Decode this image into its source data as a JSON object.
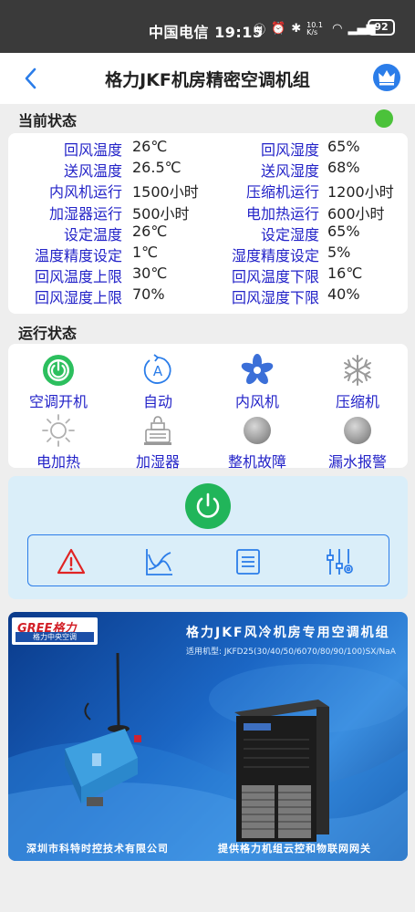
{
  "status_bar": {
    "carrier_time": "中国电信 19:15",
    "net_speed": "10.1 K/s",
    "battery": "92"
  },
  "header": {
    "title": "格力JKF机房精密空调机组"
  },
  "current_status": {
    "title": "当前状态",
    "indicator_color": "#4bc23a",
    "rows": [
      {
        "l_label": "回风温度",
        "l_value": "26℃",
        "r_label": "回风湿度",
        "r_value": "65%"
      },
      {
        "l_label": "送风温度",
        "l_value": "26.5℃",
        "r_label": "送风湿度",
        "r_value": "68%"
      },
      {
        "l_label": "内风机运行",
        "l_value": "1500小时",
        "r_label": "压缩机运行",
        "r_value": "1200小时"
      },
      {
        "l_label": "加湿器运行",
        "l_value": "500小时",
        "r_label": "电加热运行",
        "r_value": "600小时"
      },
      {
        "l_label": "设定温度",
        "l_value": "26℃",
        "r_label": "设定湿度",
        "r_value": "65%"
      },
      {
        "l_label": "温度精度设定",
        "l_value": "1℃",
        "r_label": "湿度精度设定",
        "r_value": "5%"
      },
      {
        "l_label": "回风温度上限",
        "l_value": "30℃",
        "r_label": "回风温度下限",
        "r_value": "16℃"
      },
      {
        "l_label": "回风湿度上限",
        "l_value": "70%",
        "r_label": "回风湿度下限",
        "r_value": "40%"
      }
    ]
  },
  "run_status": {
    "title": "运行状态",
    "items": [
      {
        "label": "空调开机",
        "icon": "power-on-icon"
      },
      {
        "label": "自动",
        "icon": "auto-mode-icon"
      },
      {
        "label": "内风机",
        "icon": "fan-icon"
      },
      {
        "label": "压缩机",
        "icon": "snowflake-icon"
      },
      {
        "label": "电加热",
        "icon": "sun-heater-icon"
      },
      {
        "label": "加湿器",
        "icon": "humidifier-icon"
      },
      {
        "label": "整机故障",
        "icon": "fault-indicator-icon"
      },
      {
        "label": "漏水报警",
        "icon": "leak-alarm-icon"
      }
    ]
  },
  "controls": {
    "power_color": "#21b55a",
    "tools": [
      "alarm-icon",
      "curve-chart-icon",
      "list-icon",
      "settings-sliders-icon"
    ]
  },
  "banner": {
    "logo_text": "GREE格力",
    "logo_sub": "格力中央空调",
    "title": "格力JKF风冷机房专用空调机组",
    "subtitle": "适用机型: JKFD25(30/40/50/6070/80/90/100)SX/NaA",
    "footer_left": "深圳市科特时控技术有限公司",
    "footer_right": "提供格力机组云控和物联网网关"
  },
  "colors": {
    "accent": "#2b7de9",
    "label_blue": "#2323c8",
    "ok_green": "#4bc23a"
  }
}
